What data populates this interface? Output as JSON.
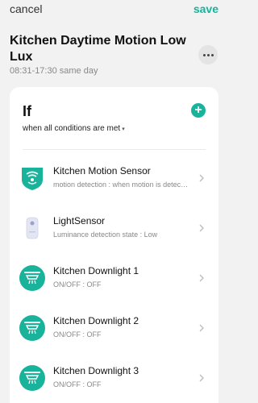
{
  "topbar": {
    "cancel_label": "cancel",
    "save_label": "save"
  },
  "scene": {
    "title": "Kitchen Daytime Motion Low Lux",
    "time_range": "08:31-17:30 same day"
  },
  "if_section": {
    "label": "If",
    "condition_mode": "when all conditions are met",
    "add_icon": "plus-icon",
    "items": [
      {
        "name": "Kitchen Motion Sensor",
        "detail": "motion detection : when motion is detected",
        "icon": "motion-sensor-icon"
      },
      {
        "name": "LightSensor",
        "detail": "Luminance detection state : Low",
        "icon": "light-sensor-device-icon"
      },
      {
        "name": "Kitchen Downlight 1",
        "detail": "ON/OFF : OFF",
        "icon": "downlight-icon"
      },
      {
        "name": "Kitchen Downlight 2",
        "detail": "ON/OFF : OFF",
        "icon": "downlight-icon"
      },
      {
        "name": "Kitchen Downlight 3",
        "detail": "ON/OFF : OFF",
        "icon": "downlight-icon"
      }
    ]
  },
  "colors": {
    "accent": "#19b39b",
    "background": "#f2f2f2",
    "card": "#ffffff"
  }
}
